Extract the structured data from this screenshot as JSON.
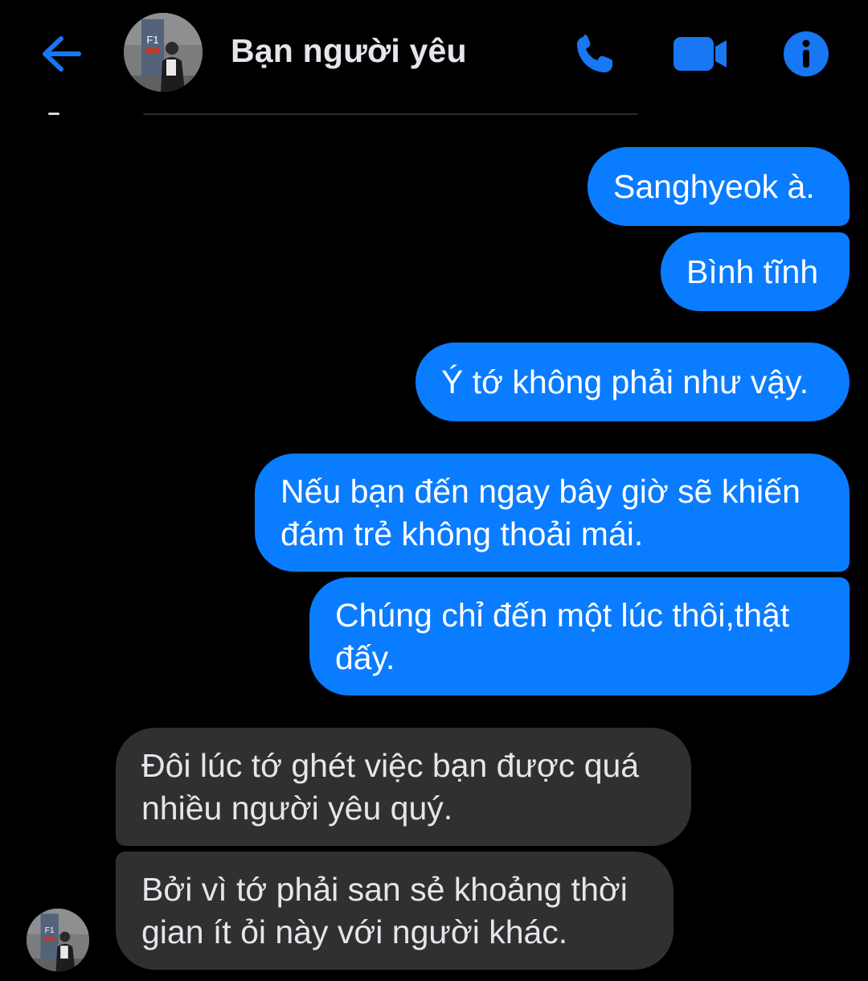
{
  "header": {
    "title": "Bạn người yêu",
    "avatar_sign_text": "F1",
    "accent_color": "#0a7cff",
    "icons": [
      "back-arrow-icon",
      "phone-icon",
      "video-camera-icon",
      "info-icon"
    ]
  },
  "messages": [
    {
      "sender": "me",
      "lines": [
        "Sanghyeok à."
      ]
    },
    {
      "sender": "me",
      "lines": [
        "Bình tĩnh"
      ]
    },
    {
      "sender": "me",
      "lines": [
        "Ý tớ không phải như vậy."
      ]
    },
    {
      "sender": "me",
      "lines": [
        "Nếu bạn đến ngay bây giờ sẽ khiến",
        "đám trẻ không thoải mái."
      ]
    },
    {
      "sender": "me",
      "lines": [
        "Chúng chỉ đến một lúc thôi,thật",
        "đấy."
      ]
    },
    {
      "sender": "them",
      "lines": [
        "Đôi lúc tớ ghét việc bạn được quá",
        "nhiều người yêu quý."
      ]
    },
    {
      "sender": "them",
      "lines": [
        "Bởi vì tớ phải san sẻ khoảng thời",
        "gian ít ỏi này với người khác."
      ]
    }
  ],
  "colors": {
    "background": "#000000",
    "outgoing_bubble": "#0a7cff",
    "incoming_bubble": "#303030",
    "text_light": "#e4e6eb"
  }
}
